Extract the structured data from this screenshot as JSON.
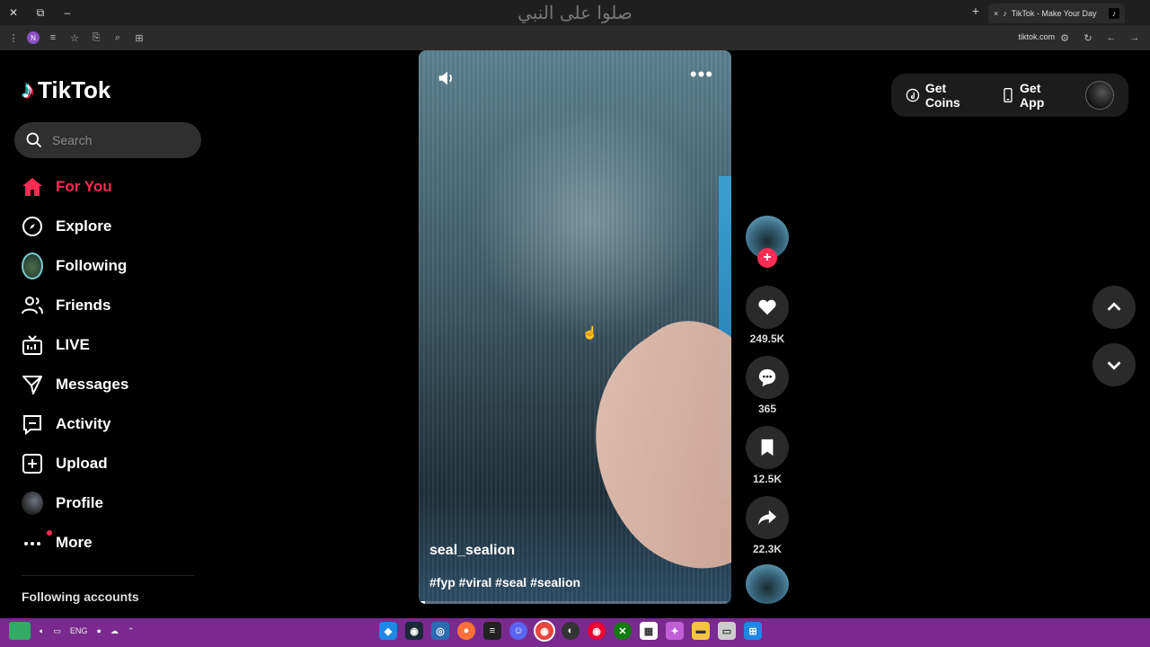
{
  "window": {
    "title_overlay": "صلوا على النبي"
  },
  "browser": {
    "tab_title": "TikTok - Make Your Day",
    "new_tab": "+",
    "close_tab": "×",
    "profile_initial": "N",
    "url": "tiktok.com"
  },
  "sidebar": {
    "logo_text": "TikTok",
    "search_placeholder": "Search",
    "items": [
      {
        "label": "For You",
        "icon": "home-icon",
        "active": true
      },
      {
        "label": "Explore",
        "icon": "compass-icon"
      },
      {
        "label": "Following",
        "icon": "following-avatar"
      },
      {
        "label": "Friends",
        "icon": "friends-icon"
      },
      {
        "label": "LIVE",
        "icon": "live-icon"
      },
      {
        "label": "Messages",
        "icon": "messages-icon"
      },
      {
        "label": "Activity",
        "icon": "activity-icon"
      },
      {
        "label": "Upload",
        "icon": "upload-icon"
      },
      {
        "label": "Profile",
        "icon": "profile-avatar"
      },
      {
        "label": "More",
        "icon": "more-icon"
      }
    ],
    "following_accounts": "Following accounts"
  },
  "video": {
    "author": "seal_sealion",
    "hashtags": "#fyp #viral #seal #sealion",
    "progress": 0.02
  },
  "actions": {
    "likes": "249.5K",
    "comments": "365",
    "saves": "12.5K",
    "shares": "22.3K"
  },
  "header": {
    "get_coins": "Get Coins",
    "get_app": "Get App"
  },
  "taskbar": {
    "lang": "ENG"
  },
  "colors": {
    "accent": "#fe2c55",
    "taskbar": "#7a2a8e"
  }
}
